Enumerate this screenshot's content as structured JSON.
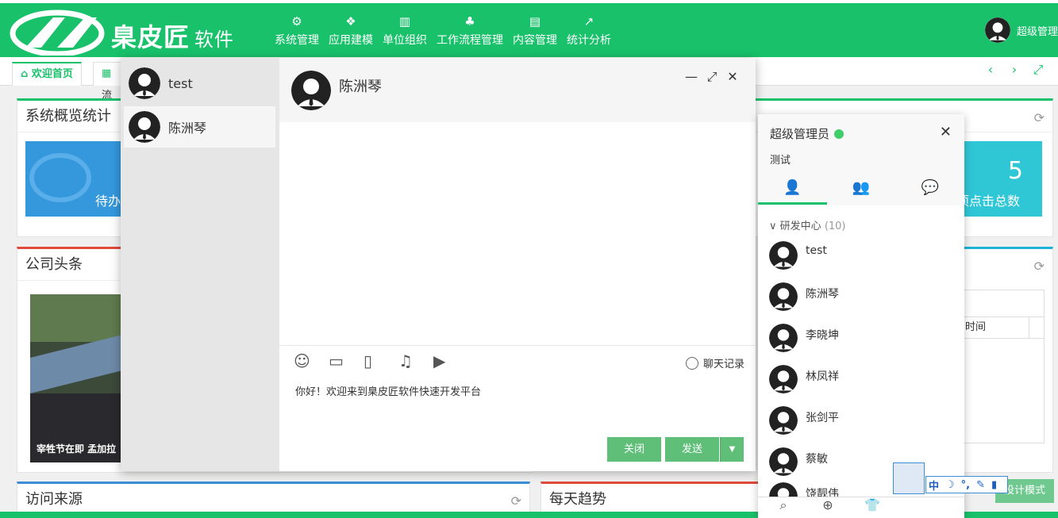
{
  "header": {
    "brand": "臬皮匠",
    "brand_sub": "软件",
    "nav": [
      {
        "icon": "gears-icon",
        "label": "系统管理"
      },
      {
        "icon": "cubes-icon",
        "label": "应用建模"
      },
      {
        "icon": "bank-icon",
        "label": "单位组织"
      },
      {
        "icon": "sitemap-icon",
        "label": "工作流程管理"
      },
      {
        "icon": "newspaper-icon",
        "label": "内容管理"
      },
      {
        "icon": "line-chart-icon",
        "label": "统计分析"
      }
    ],
    "user": "超级管理"
  },
  "tabs": {
    "home": "欢迎首页",
    "second": "流"
  },
  "panels": {
    "overview_title": "系统概览统计",
    "todo_label": "待办",
    "click_total": "5",
    "click_label": "项点击总数",
    "news_title": "公司头条",
    "news_caption": "宰牲节在即 孟加拉",
    "visit_title": "访问来源",
    "trend_title": "每天趋势",
    "table_col": "时间",
    "design_mode": "设计模式"
  },
  "chat": {
    "conversations": [
      {
        "name": "test"
      },
      {
        "name": "陈洲琴"
      }
    ],
    "active_name": "陈洲琴",
    "history_label": "聊天记录",
    "input_text": "你好！欢迎来到臬皮匠软件快速开发平台",
    "close_label": "关闭",
    "send_label": "发送"
  },
  "contacts": {
    "me": "超级管理员",
    "signature": "测试",
    "group": "研发中心",
    "group_count": "(10)",
    "members": [
      "test",
      "陈洲琴",
      "李晓坤",
      "林凤祥",
      "张剑平",
      "蔡敏",
      "饶靓伟"
    ]
  },
  "ime": {
    "mode": "中"
  }
}
